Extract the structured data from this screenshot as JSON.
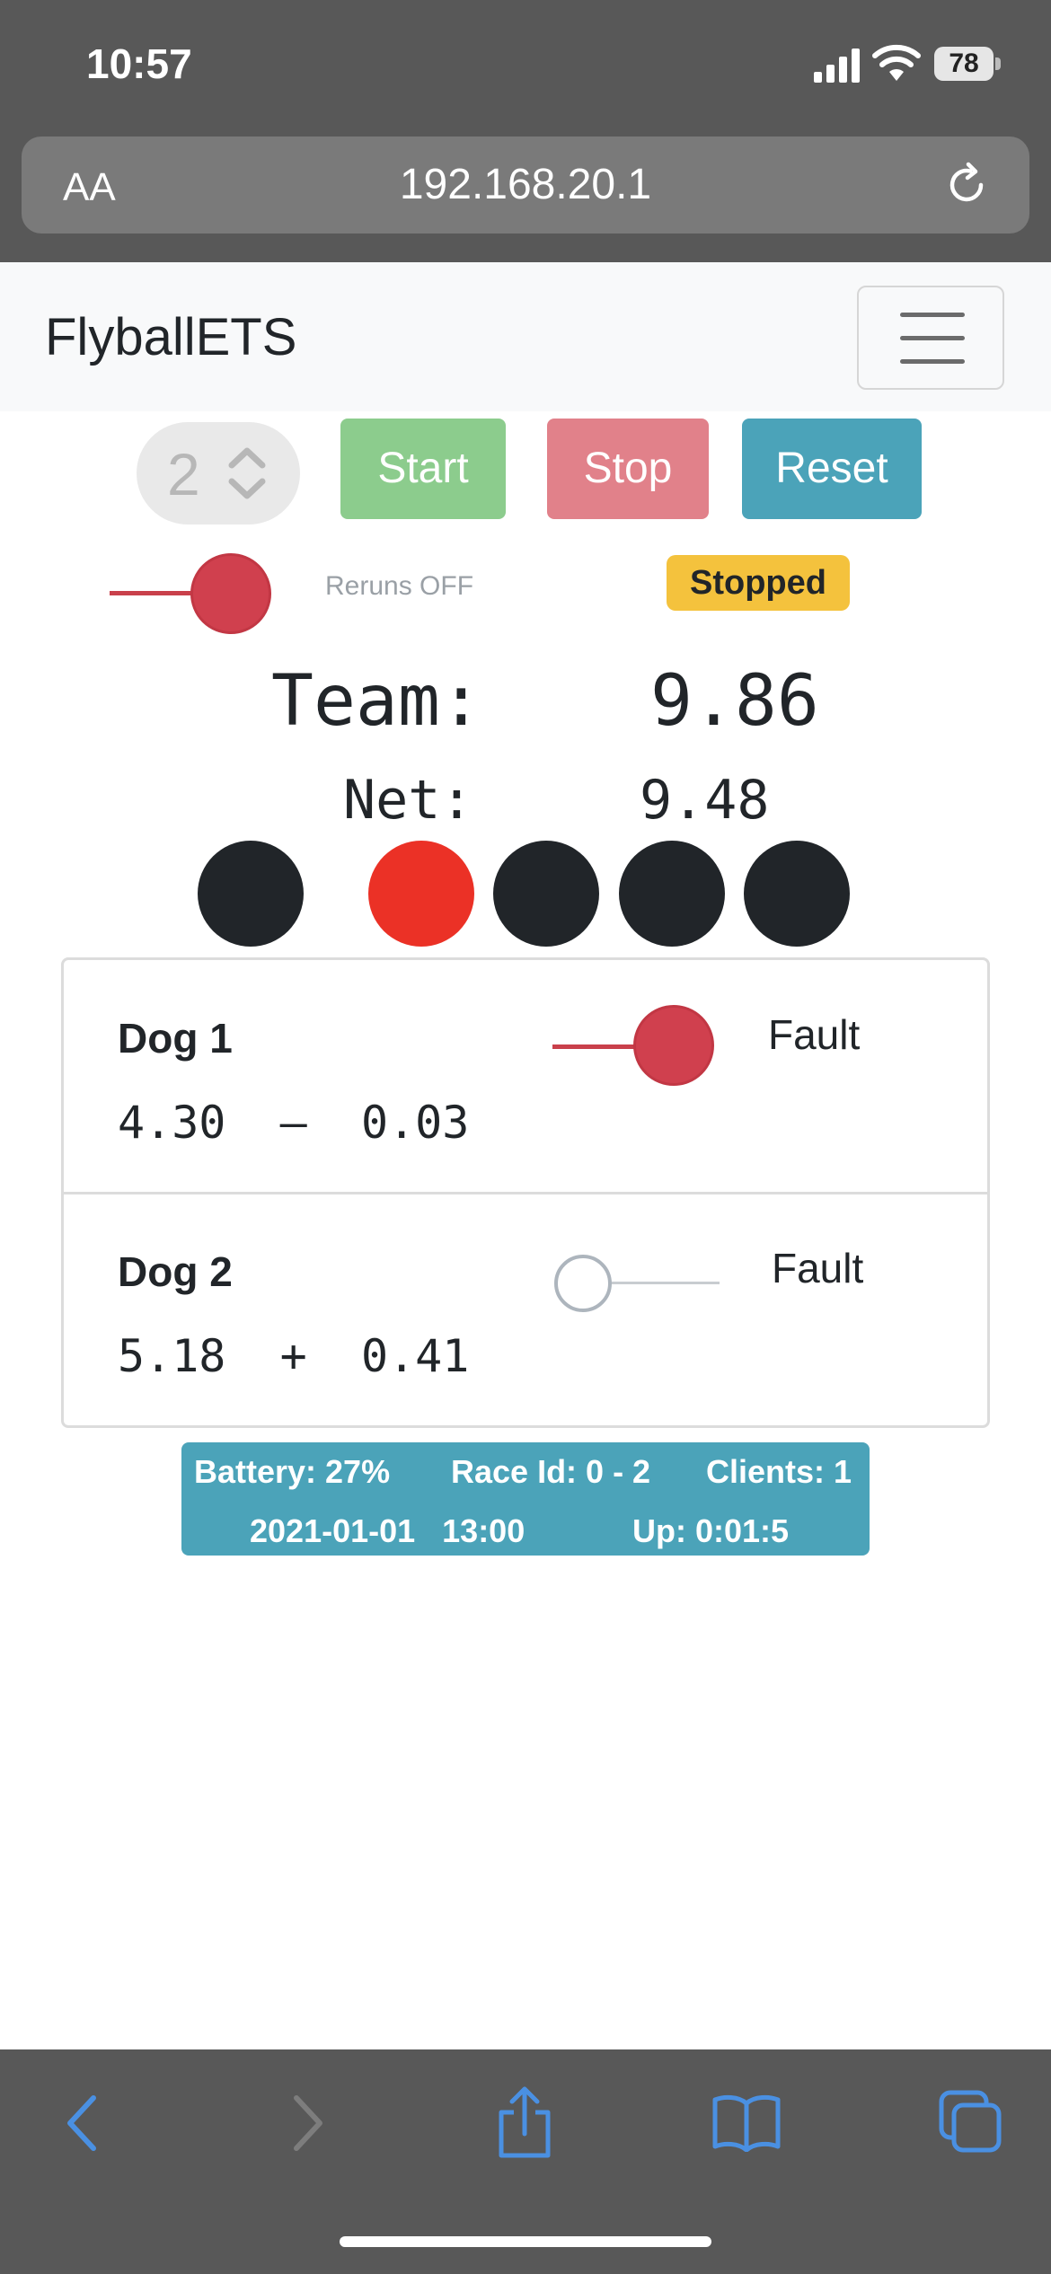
{
  "status_bar": {
    "time": "10:57",
    "battery": "78"
  },
  "browser": {
    "aa_label": "AA",
    "url": "192.168.20.1"
  },
  "navbar": {
    "brand": "FlyballETS"
  },
  "controls": {
    "race_number": "2",
    "start_label": "Start",
    "stop_label": "Stop",
    "reset_label": "Reset",
    "reruns_label": "Reruns OFF",
    "status_badge": "Stopped"
  },
  "times": {
    "team_label": "Team:",
    "team_value": "9.86",
    "net_label": "Net:",
    "net_value": "9.48"
  },
  "lights": [
    "dark",
    "red",
    "dark",
    "dark",
    "dark"
  ],
  "dogs": [
    {
      "name": "Dog 1",
      "time": "4.30",
      "sign": "–",
      "crossing": "0.03",
      "fault_label": "Fault",
      "fault_on": true
    },
    {
      "name": "Dog 2",
      "time": "5.18",
      "sign": "+",
      "crossing": "0.41",
      "fault_label": "Fault",
      "fault_on": false
    }
  ],
  "info": {
    "battery": "Battery: 27%",
    "race_id": "Race Id: 0 - 2",
    "clients": "Clients: 1",
    "datetime": "2021-01-01   13:00",
    "uptime": "Up: 0:01:5"
  },
  "colors": {
    "start": "#8ccc8d",
    "stop": "#e1818a",
    "reset": "#4ba3b9",
    "badge": "#f4c23d",
    "switch_on": "#d0404e",
    "light_red": "#eb3126",
    "light_dark": "#212529",
    "toolbar_icon": "#4a90e2"
  },
  "toolbar": {
    "icons": [
      "back-icon",
      "forward-icon",
      "share-icon",
      "bookmarks-icon",
      "tabs-icon"
    ]
  }
}
